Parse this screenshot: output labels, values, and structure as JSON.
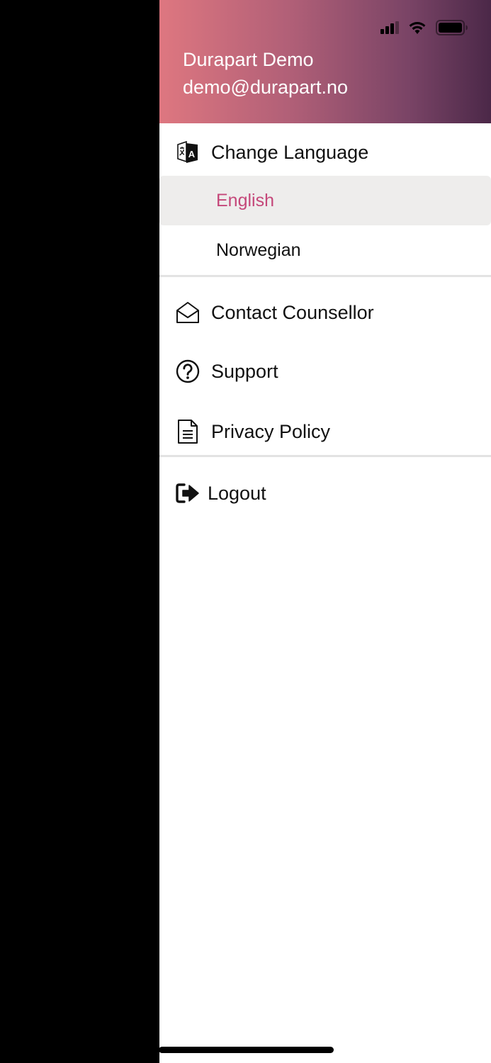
{
  "status_bar": {
    "icons": [
      "cellular-signal-icon",
      "wifi-icon",
      "battery-icon"
    ]
  },
  "header": {
    "user_name": "Durapart Demo",
    "user_email": "demo@durapart.no",
    "gradient_colors": [
      "#de7780",
      "#4b2848"
    ]
  },
  "menu": {
    "change_language": {
      "label": "Change Language",
      "icon": "translate-icon"
    },
    "languages": [
      {
        "label": "English",
        "selected": true
      },
      {
        "label": "Norwegian",
        "selected": false
      }
    ],
    "contact_counsellor": {
      "label": "Contact Counsellor",
      "icon": "envelope-open-icon"
    },
    "support": {
      "label": "Support",
      "icon": "question-circle-icon"
    },
    "privacy_policy": {
      "label": "Privacy Policy",
      "icon": "document-icon"
    },
    "logout": {
      "label": "Logout",
      "icon": "logout-icon"
    }
  },
  "colors": {
    "accent": "#c5487a",
    "selected_bg": "#eeedec"
  }
}
